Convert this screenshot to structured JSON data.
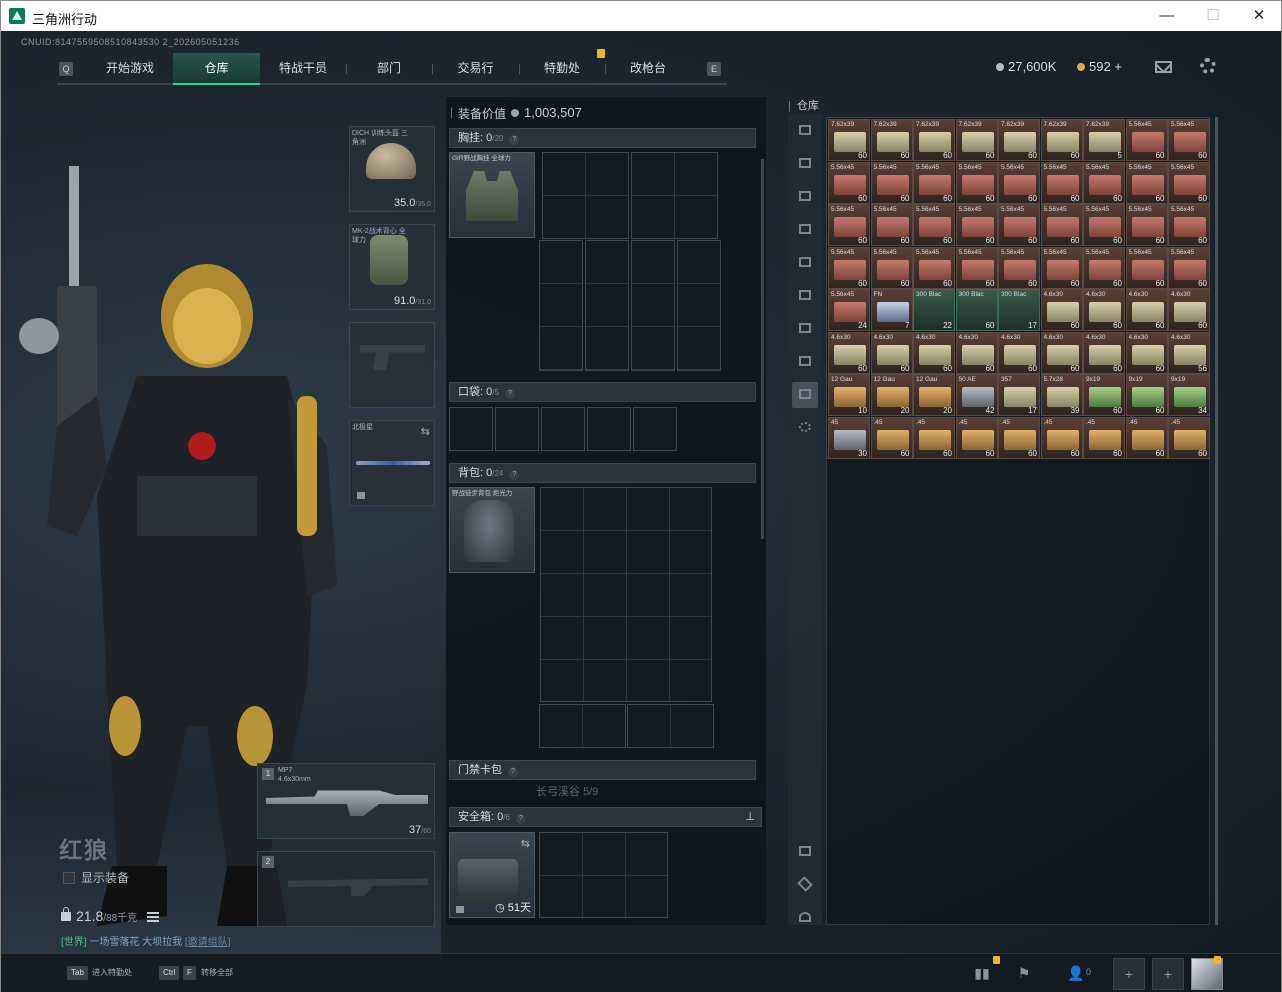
{
  "window": {
    "title": "三角洲行动",
    "minimize": "—",
    "maximize": "☐",
    "close": "✕"
  },
  "uid": "CNUID:8147559508510843530 2_202605051236",
  "nav": {
    "left_key": "Q",
    "right_key": "E",
    "tabs": [
      "开始游戏",
      "仓库",
      "特战干员",
      "部门",
      "交易行",
      "特勤处",
      "改枪台"
    ],
    "active": "仓库"
  },
  "currency": {
    "silver": "27,600K",
    "gold": "592",
    "plus": "+",
    "silver_color": "#b8bec4",
    "gold_color": "#d9a85a"
  },
  "operator": {
    "name": "红狼",
    "show_equipment": "显示装备",
    "weight": "21.8",
    "weight_max": "/88千克"
  },
  "chat": {
    "channel": "[世界]",
    "user": "一场雪落花",
    "message": "大坝拉我",
    "link": "[邀请组队]"
  },
  "slots": {
    "helmet": {
      "label": "DICH 训练头盔 三角洲",
      "durability": "35.0",
      "max": "/35.0"
    },
    "armor": {
      "label": "MK-2战术背心 全球力",
      "durability": "91.0",
      "max": "/91.0"
    },
    "melee": {
      "label": "北极星"
    },
    "primary": {
      "number": "1",
      "name": "MP7",
      "caliber": "4.6x30mm",
      "ammo": "37",
      "ammo_max": "/60"
    },
    "secondary": {
      "number": "2"
    }
  },
  "equipment": {
    "value_label": "装备价值",
    "value": "1,003,507",
    "chest_rig": {
      "label": "胸挂:",
      "count": "0",
      "capacity": "/20",
      "item": "GIR野战胸挂 全球力"
    },
    "pockets": {
      "label": "口袋:",
      "count": "0",
      "capacity": "/5"
    },
    "backpack": {
      "label": "背包:",
      "count": "0",
      "capacity": "/24",
      "item": "野战徒步背包 炬光力"
    },
    "keycard": {
      "label": "门禁卡包"
    },
    "long_bow": {
      "label": "长弓溪谷",
      "count": "5/9"
    },
    "safebox": {
      "label": "安全箱:",
      "count": "0",
      "capacity": "/6",
      "timer": "51天"
    }
  },
  "warehouse": {
    "title": "仓库",
    "items": [
      {
        "n": "7.62x39",
        "c": "60",
        "k": "tan"
      },
      {
        "n": "7.62x39",
        "c": "60",
        "k": "tan"
      },
      {
        "n": "7.62x39",
        "c": "60",
        "k": "tan"
      },
      {
        "n": "7.62x39",
        "c": "60",
        "k": "tan"
      },
      {
        "n": "7.62x39",
        "c": "60",
        "k": "tan"
      },
      {
        "n": "7.62x39",
        "c": "60",
        "k": "tan"
      },
      {
        "n": "7.62x39",
        "c": "5",
        "k": "tan"
      },
      {
        "n": "5.56x45",
        "c": "60",
        "k": "red"
      },
      {
        "n": "5.56x45",
        "c": "60",
        "k": "red"
      },
      {
        "n": "5.56x45",
        "c": "60",
        "k": "red"
      },
      {
        "n": "5.56x45",
        "c": "60",
        "k": "red"
      },
      {
        "n": "5.56x45",
        "c": "60",
        "k": "red"
      },
      {
        "n": "5.56x45",
        "c": "60",
        "k": "red"
      },
      {
        "n": "5.56x45",
        "c": "60",
        "k": "red"
      },
      {
        "n": "5.56x45",
        "c": "60",
        "k": "red"
      },
      {
        "n": "5.56x45",
        "c": "60",
        "k": "red"
      },
      {
        "n": "5.56x45",
        "c": "60",
        "k": "red"
      },
      {
        "n": "5.56x45",
        "c": "60",
        "k": "red"
      },
      {
        "n": "5.56x45",
        "c": "60",
        "k": "red"
      },
      {
        "n": "5.56x45",
        "c": "60",
        "k": "red"
      },
      {
        "n": "5.56x45",
        "c": "60",
        "k": "red"
      },
      {
        "n": "5.56x45",
        "c": "60",
        "k": "red"
      },
      {
        "n": "5.56x45",
        "c": "60",
        "k": "red"
      },
      {
        "n": "5.56x45",
        "c": "60",
        "k": "red"
      },
      {
        "n": "5.56x45",
        "c": "60",
        "k": "red"
      },
      {
        "n": "5.56x45",
        "c": "60",
        "k": "red"
      },
      {
        "n": "5.56x45",
        "c": "60",
        "k": "red"
      },
      {
        "n": "5.56x45",
        "c": "60",
        "k": "red"
      },
      {
        "n": "5.56x45",
        "c": "60",
        "k": "red"
      },
      {
        "n": "5.56x45",
        "c": "60",
        "k": "red"
      },
      {
        "n": "5.56x45",
        "c": "60",
        "k": "red"
      },
      {
        "n": "5.56x45",
        "c": "60",
        "k": "red"
      },
      {
        "n": "5.56x45",
        "c": "60",
        "k": "red"
      },
      {
        "n": "5.56x45",
        "c": "60",
        "k": "red"
      },
      {
        "n": "5.56x45",
        "c": "60",
        "k": "red"
      },
      {
        "n": "5.56x45",
        "c": "60",
        "k": "red"
      },
      {
        "n": "5.56x45",
        "c": "24",
        "k": "red"
      },
      {
        "n": "FN",
        "c": "7",
        "k": "blue"
      },
      {
        "n": "300 Blac",
        "c": "22",
        "k": "teal"
      },
      {
        "n": "300 Blac",
        "c": "60",
        "k": "teal"
      },
      {
        "n": "300 Blac",
        "c": "17",
        "k": "teal"
      },
      {
        "n": "4.6x30",
        "c": "60",
        "k": "tan"
      },
      {
        "n": "4.6x30",
        "c": "60",
        "k": "tan"
      },
      {
        "n": "4.6x30",
        "c": "60",
        "k": "tan"
      },
      {
        "n": "4.6x30",
        "c": "60",
        "k": "tan"
      },
      {
        "n": "4.6x30",
        "c": "60",
        "k": "tan"
      },
      {
        "n": "4.6x30",
        "c": "60",
        "k": "tan"
      },
      {
        "n": "4.6x30",
        "c": "60",
        "k": "tan"
      },
      {
        "n": "4.6x30",
        "c": "60",
        "k": "tan"
      },
      {
        "n": "4.6x30",
        "c": "60",
        "k": "tan"
      },
      {
        "n": "4.6x30",
        "c": "60",
        "k": "tan"
      },
      {
        "n": "4.6x30",
        "c": "60",
        "k": "tan"
      },
      {
        "n": "4.6x30",
        "c": "60",
        "k": "tan"
      },
      {
        "n": "4.6x30",
        "c": "56",
        "k": "tan"
      },
      {
        "n": "12 Gau",
        "c": "10",
        "k": "crate"
      },
      {
        "n": "12 Gau",
        "c": "20",
        "k": "crate"
      },
      {
        "n": "12 Gau",
        "c": "20",
        "k": "crate"
      },
      {
        "n": "50 AE",
        "c": "42",
        "k": "steel"
      },
      {
        "n": "357",
        "c": "17",
        "k": "tan"
      },
      {
        "n": "5.7x28",
        "c": "39",
        "k": "tan"
      },
      {
        "n": "9x19",
        "c": "60",
        "k": "grn"
      },
      {
        "n": "9x19",
        "c": "60",
        "k": "grn"
      },
      {
        "n": "9x19",
        "c": "34",
        "k": "grn"
      },
      {
        "n": "45",
        "c": "30",
        "k": "steel"
      },
      {
        "n": ".45",
        "c": "60",
        "k": "crate"
      },
      {
        "n": ".45",
        "c": "60",
        "k": "crate"
      },
      {
        "n": ".45",
        "c": "60",
        "k": "crate"
      },
      {
        "n": ".45",
        "c": "60",
        "k": "crate"
      },
      {
        "n": ".45",
        "c": "60",
        "k": "crate"
      },
      {
        "n": ".45",
        "c": "60",
        "k": "crate"
      },
      {
        "n": ".45",
        "c": "60",
        "k": "crate"
      },
      {
        "n": ".45",
        "c": "60",
        "k": "crate"
      }
    ]
  },
  "bottom": {
    "tab_key": "Tab",
    "tab_label": "进入特勤处",
    "ctrl_key": "Ctrl",
    "f_key": "F",
    "ctrl_label": "转移全部",
    "squad_count": "0",
    "plus": "+"
  }
}
